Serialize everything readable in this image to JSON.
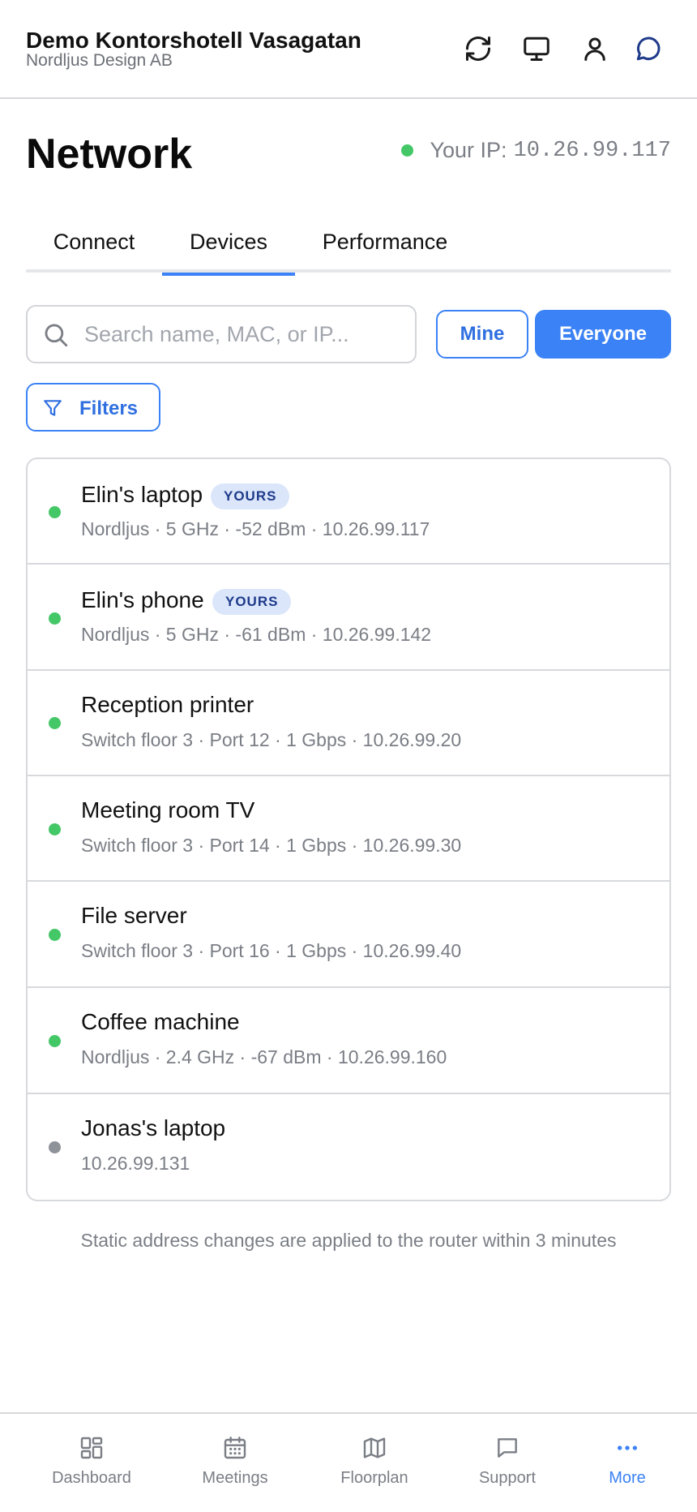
{
  "header": {
    "org_name": "Demo Kontorshotell Vasagatan",
    "org_sub": "Nordljus Design AB",
    "icons": [
      "refresh-icon",
      "monitor-icon",
      "user-icon",
      "chat-icon"
    ]
  },
  "page": {
    "title": "Network",
    "ip_label": "Your IP:",
    "ip_value": "10.26.99.117",
    "ip_status_color": "#44c766"
  },
  "tabs": [
    {
      "label": "Connect",
      "active": false
    },
    {
      "label": "Devices",
      "active": true
    },
    {
      "label": "Performance",
      "active": false
    }
  ],
  "search": {
    "placeholder": "Search name, MAC, or IP...",
    "value": ""
  },
  "scope": {
    "mine_label": "Mine",
    "everyone_label": "Everyone",
    "selected": "Everyone"
  },
  "filters": {
    "label": "Filters"
  },
  "devices": [
    {
      "name": "Elin's laptop",
      "badge": "YOURS",
      "meta": "Nordljus · 5 GHz · -52 dBm · 10.26.99.117",
      "status": "online"
    },
    {
      "name": "Elin's phone",
      "badge": "YOURS",
      "meta": "Nordljus · 5 GHz · -61 dBm · 10.26.99.142",
      "status": "online"
    },
    {
      "name": "Reception printer",
      "badge": "",
      "meta": "Switch floor 3 · Port 12 · 1 Gbps · 10.26.99.20",
      "status": "online"
    },
    {
      "name": "Meeting room TV",
      "badge": "",
      "meta": "Switch floor 3 · Port 14 · 1 Gbps · 10.26.99.30",
      "status": "online"
    },
    {
      "name": "File server",
      "badge": "",
      "meta": "Switch floor 3 · Port 16 · 1 Gbps · 10.26.99.40",
      "status": "online"
    },
    {
      "name": "Coffee machine",
      "badge": "",
      "meta": "Nordljus · 2.4 GHz · -67 dBm · 10.26.99.160",
      "status": "online"
    },
    {
      "name": "Jonas's laptop",
      "badge": "",
      "meta": "10.26.99.131",
      "status": "offline"
    }
  ],
  "footnote": "Static address changes are applied to the router within 3 minutes",
  "bottom_nav": [
    {
      "label": "Dashboard",
      "icon": "dashboard-icon",
      "active": false
    },
    {
      "label": "Meetings",
      "icon": "calendar-icon",
      "active": false
    },
    {
      "label": "Floorplan",
      "icon": "map-icon",
      "active": false
    },
    {
      "label": "Support",
      "icon": "chat-icon",
      "active": false
    },
    {
      "label": "More",
      "icon": "more-icon",
      "active": true
    }
  ],
  "colors": {
    "accent": "#3b82f6",
    "online": "#44c766",
    "offline": "#8e9299"
  }
}
